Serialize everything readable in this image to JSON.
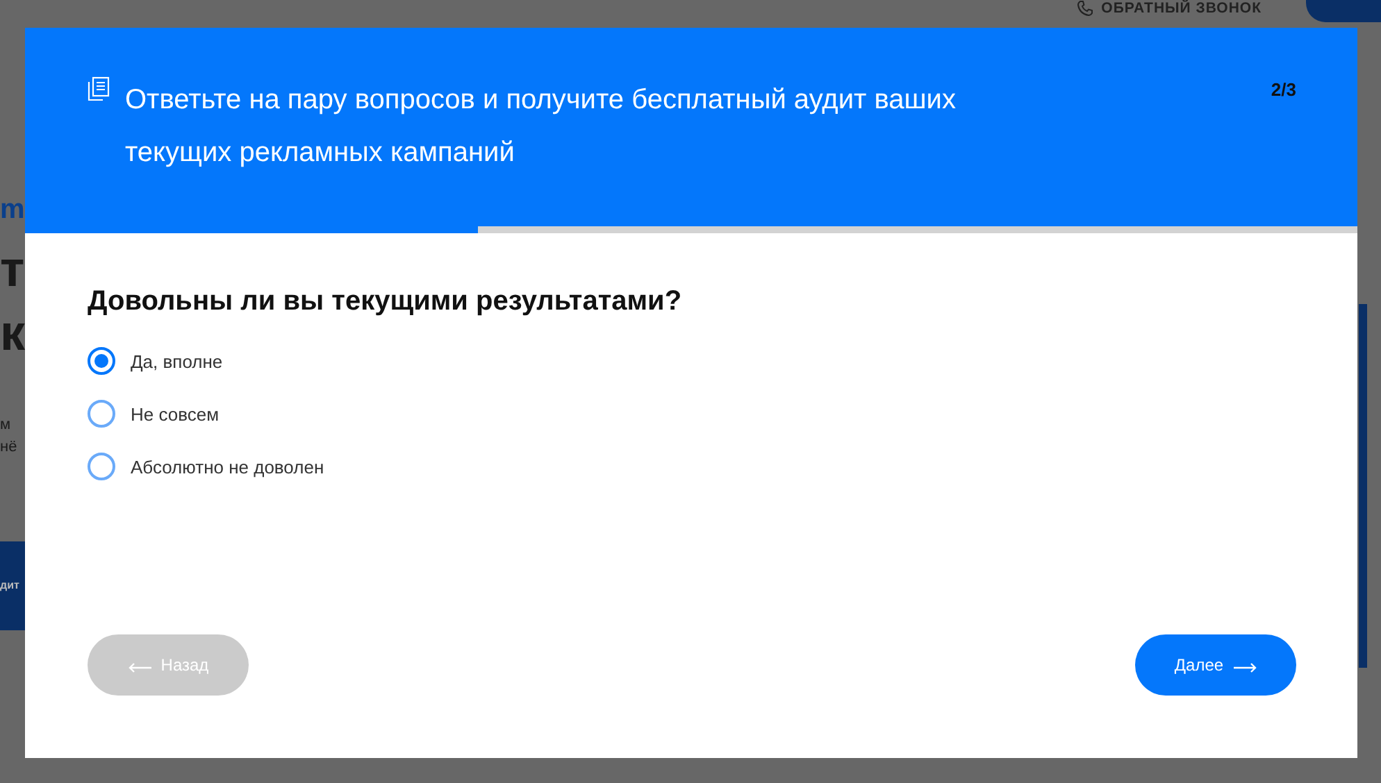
{
  "background": {
    "callback_link": "ОБРАТНЫЙ ЗВОНОК",
    "fragments": [
      {
        "kind": "logo",
        "text": "m"
      },
      {
        "kind": "heading",
        "text": "т"
      },
      {
        "kind": "heading",
        "text": "к"
      },
      {
        "kind": "body",
        "text": "м"
      },
      {
        "kind": "body",
        "text": "нё"
      },
      {
        "kind": "button",
        "text": "дит"
      }
    ]
  },
  "modal": {
    "title": "Ответьте на пару вопросов и получите бесплатный аудит ваших текущих рекламных кампаний",
    "step": "2/3",
    "progress": {
      "level": 0.34
    },
    "question": "Довольны ли вы текущими результатами?",
    "options": [
      {
        "label": "Да, вполне",
        "selected": true
      },
      {
        "label": "Не совсем",
        "selected": false
      },
      {
        "label": "Абсолютно не доволен",
        "selected": false
      }
    ],
    "buttons": [
      {
        "label": "Назад",
        "kind": "back",
        "disabled": true
      },
      {
        "label": "Далее",
        "kind": "next",
        "disabled": false
      }
    ]
  }
}
